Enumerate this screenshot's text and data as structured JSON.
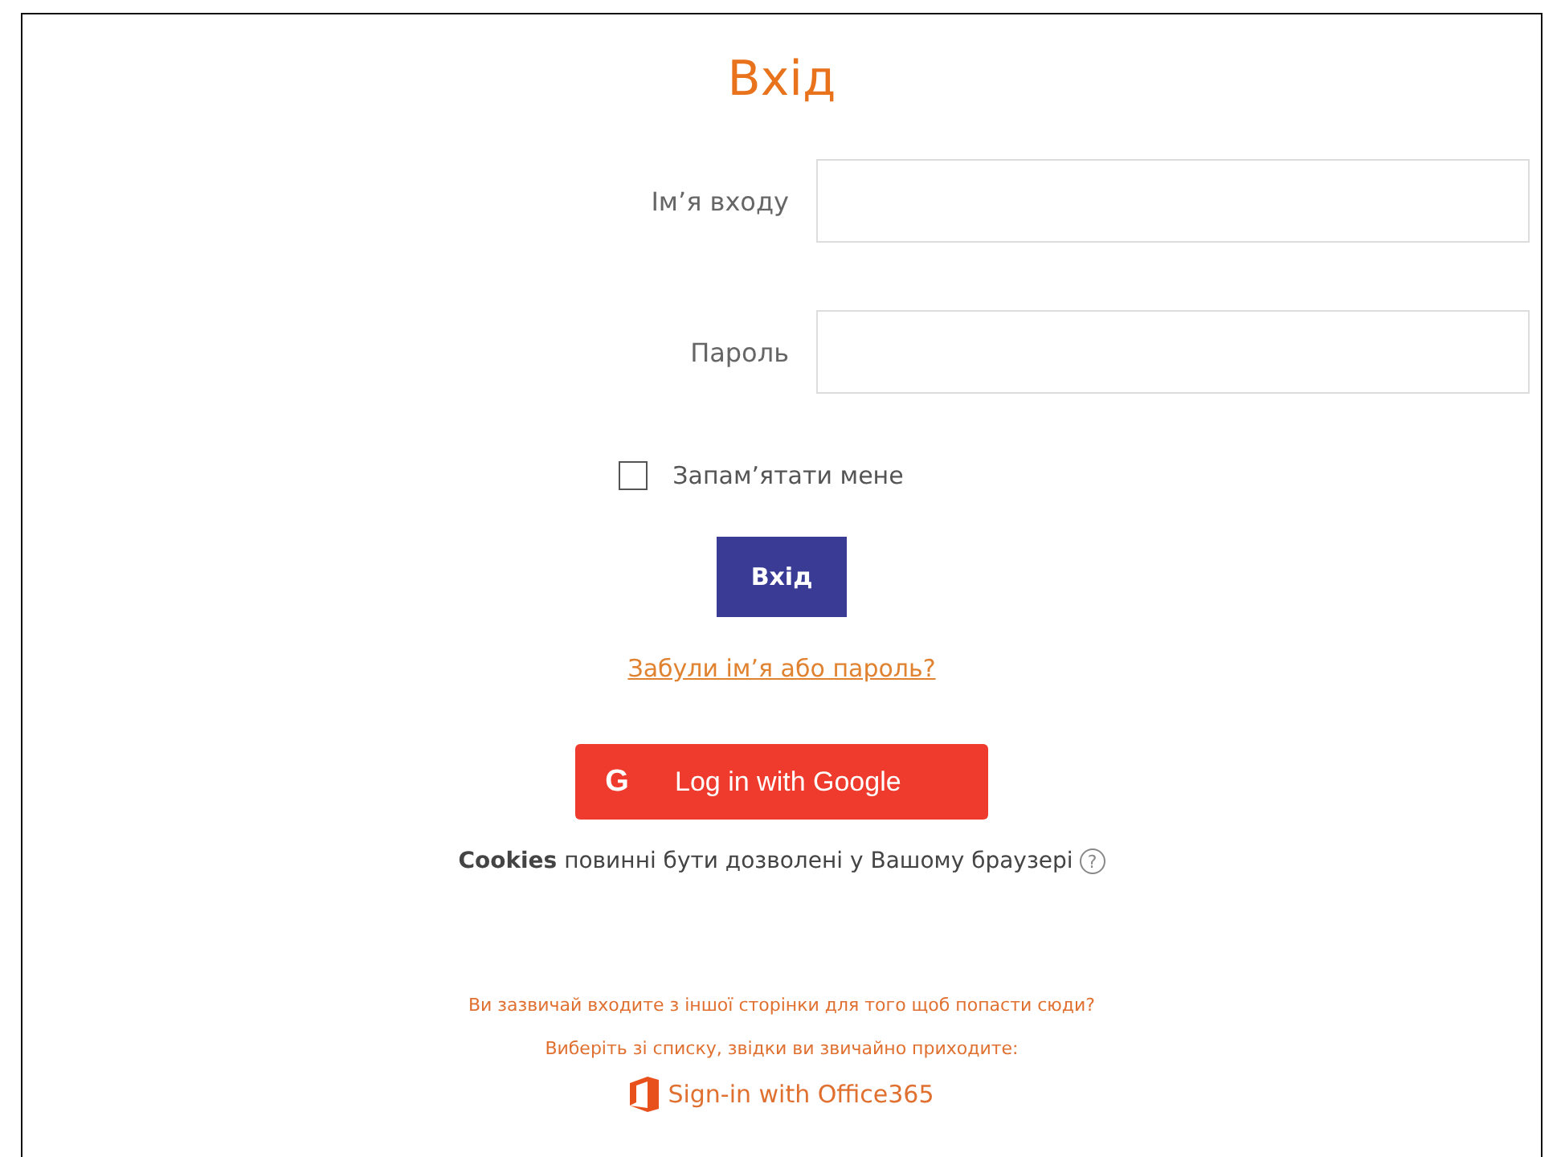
{
  "title": "Вхід",
  "fields": [
    {
      "label": "Ім’я входу"
    },
    {
      "label": "Пароль"
    }
  ],
  "remember": {
    "label": "Запам’ятати мене",
    "checked": false
  },
  "submit": "Вхід",
  "forgot_link": "Забули ім’я або пароль?",
  "google_button": {
    "icon": "G",
    "label": "Log in with Google"
  },
  "cookies_notice": "**Cookies** повинні бути дозволені у Вашому браузері",
  "help_icon": "?",
  "idp_prompt": [
    "Ви зазвичай входите з іншої сторінки для того щоб попасти сюди?",
    "Виберіть зі списку, звідки ви звичайно приходите:"
  ],
  "office_link": "Sign-in with Office365"
}
